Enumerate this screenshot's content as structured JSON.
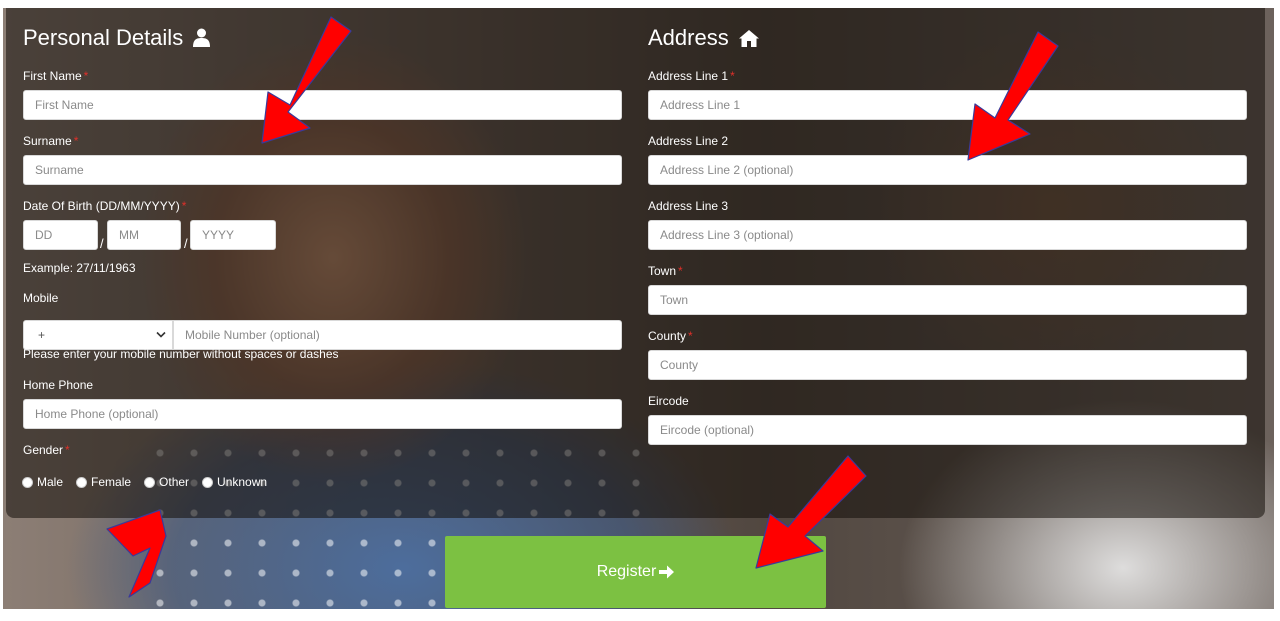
{
  "personal": {
    "title": "Personal Details",
    "first_name": {
      "label": "First Name",
      "placeholder": "First Name"
    },
    "surname": {
      "label": "Surname",
      "placeholder": "Surname"
    },
    "dob": {
      "label": "Date Of Birth (DD/MM/YYYY)",
      "day_placeholder": "DD",
      "month_placeholder": "MM",
      "year_placeholder": "YYYY",
      "separator": "/",
      "example": "Example: 27/11/1963"
    },
    "mobile": {
      "label": "Mobile",
      "country_code": "+",
      "placeholder": "Mobile Number (optional)",
      "helper": "Please enter your mobile number without spaces or dashes"
    },
    "home_phone": {
      "label": "Home Phone",
      "placeholder": "Home Phone (optional)"
    },
    "gender": {
      "label": "Gender",
      "options": [
        "Male",
        "Female",
        "Other",
        "Unknown"
      ]
    }
  },
  "address": {
    "title": "Address",
    "line1": {
      "label": "Address Line 1",
      "placeholder": "Address Line 1"
    },
    "line2": {
      "label": "Address Line 2",
      "placeholder": "Address Line 2 (optional)"
    },
    "line3": {
      "label": "Address Line 3",
      "placeholder": "Address Line 3 (optional)"
    },
    "town": {
      "label": "Town",
      "placeholder": "Town"
    },
    "county": {
      "label": "County",
      "placeholder": "County"
    },
    "eircode": {
      "label": "Eircode",
      "placeholder": "Eircode (optional)"
    }
  },
  "required_marker": "*",
  "register_label": "Register",
  "colors": {
    "accent_green": "#7cc142",
    "required_red": "#e0302a",
    "annotation_arrow": "#ff0000"
  }
}
